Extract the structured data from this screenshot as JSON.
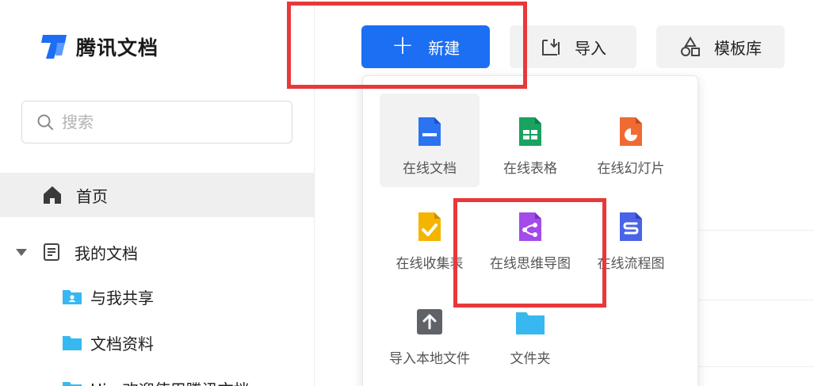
{
  "app": {
    "logo_text": "腾讯文档"
  },
  "search": {
    "placeholder": "搜索"
  },
  "sidebar": {
    "home_label": "首页",
    "mydocs_label": "我的文档",
    "subitems": [
      {
        "label": "与我共享",
        "icon": "shared-folder-icon"
      },
      {
        "label": "文档资料",
        "icon": "folder-icon"
      },
      {
        "label": "Hi，欢迎使用腾讯文档",
        "icon": "folder-icon"
      }
    ]
  },
  "toolbar": {
    "new_label": "新建",
    "import_label": "导入",
    "template_label": "模板库"
  },
  "dropdown": {
    "items": [
      {
        "label": "在线文档",
        "icon": "doc-icon",
        "color": "#2b73f0"
      },
      {
        "label": "在线表格",
        "icon": "sheet-icon",
        "color": "#1aa260"
      },
      {
        "label": "在线幻灯片",
        "icon": "slides-icon",
        "color": "#f06a33"
      },
      {
        "label": "在线收集表",
        "icon": "form-icon",
        "color": "#f5b400"
      },
      {
        "label": "在线思维导图",
        "icon": "mindmap-icon",
        "color": "#a24bea"
      },
      {
        "label": "在线流程图",
        "icon": "flowchart-icon",
        "color": "#4a63e8"
      },
      {
        "label": "导入本地文件",
        "icon": "upload-icon",
        "color": "#5f6368"
      },
      {
        "label": "文件夹",
        "icon": "folder-icon",
        "color": "#37b8f0"
      }
    ]
  },
  "colors": {
    "accent": "#1c6ef3",
    "highlight": "#e8383a"
  }
}
